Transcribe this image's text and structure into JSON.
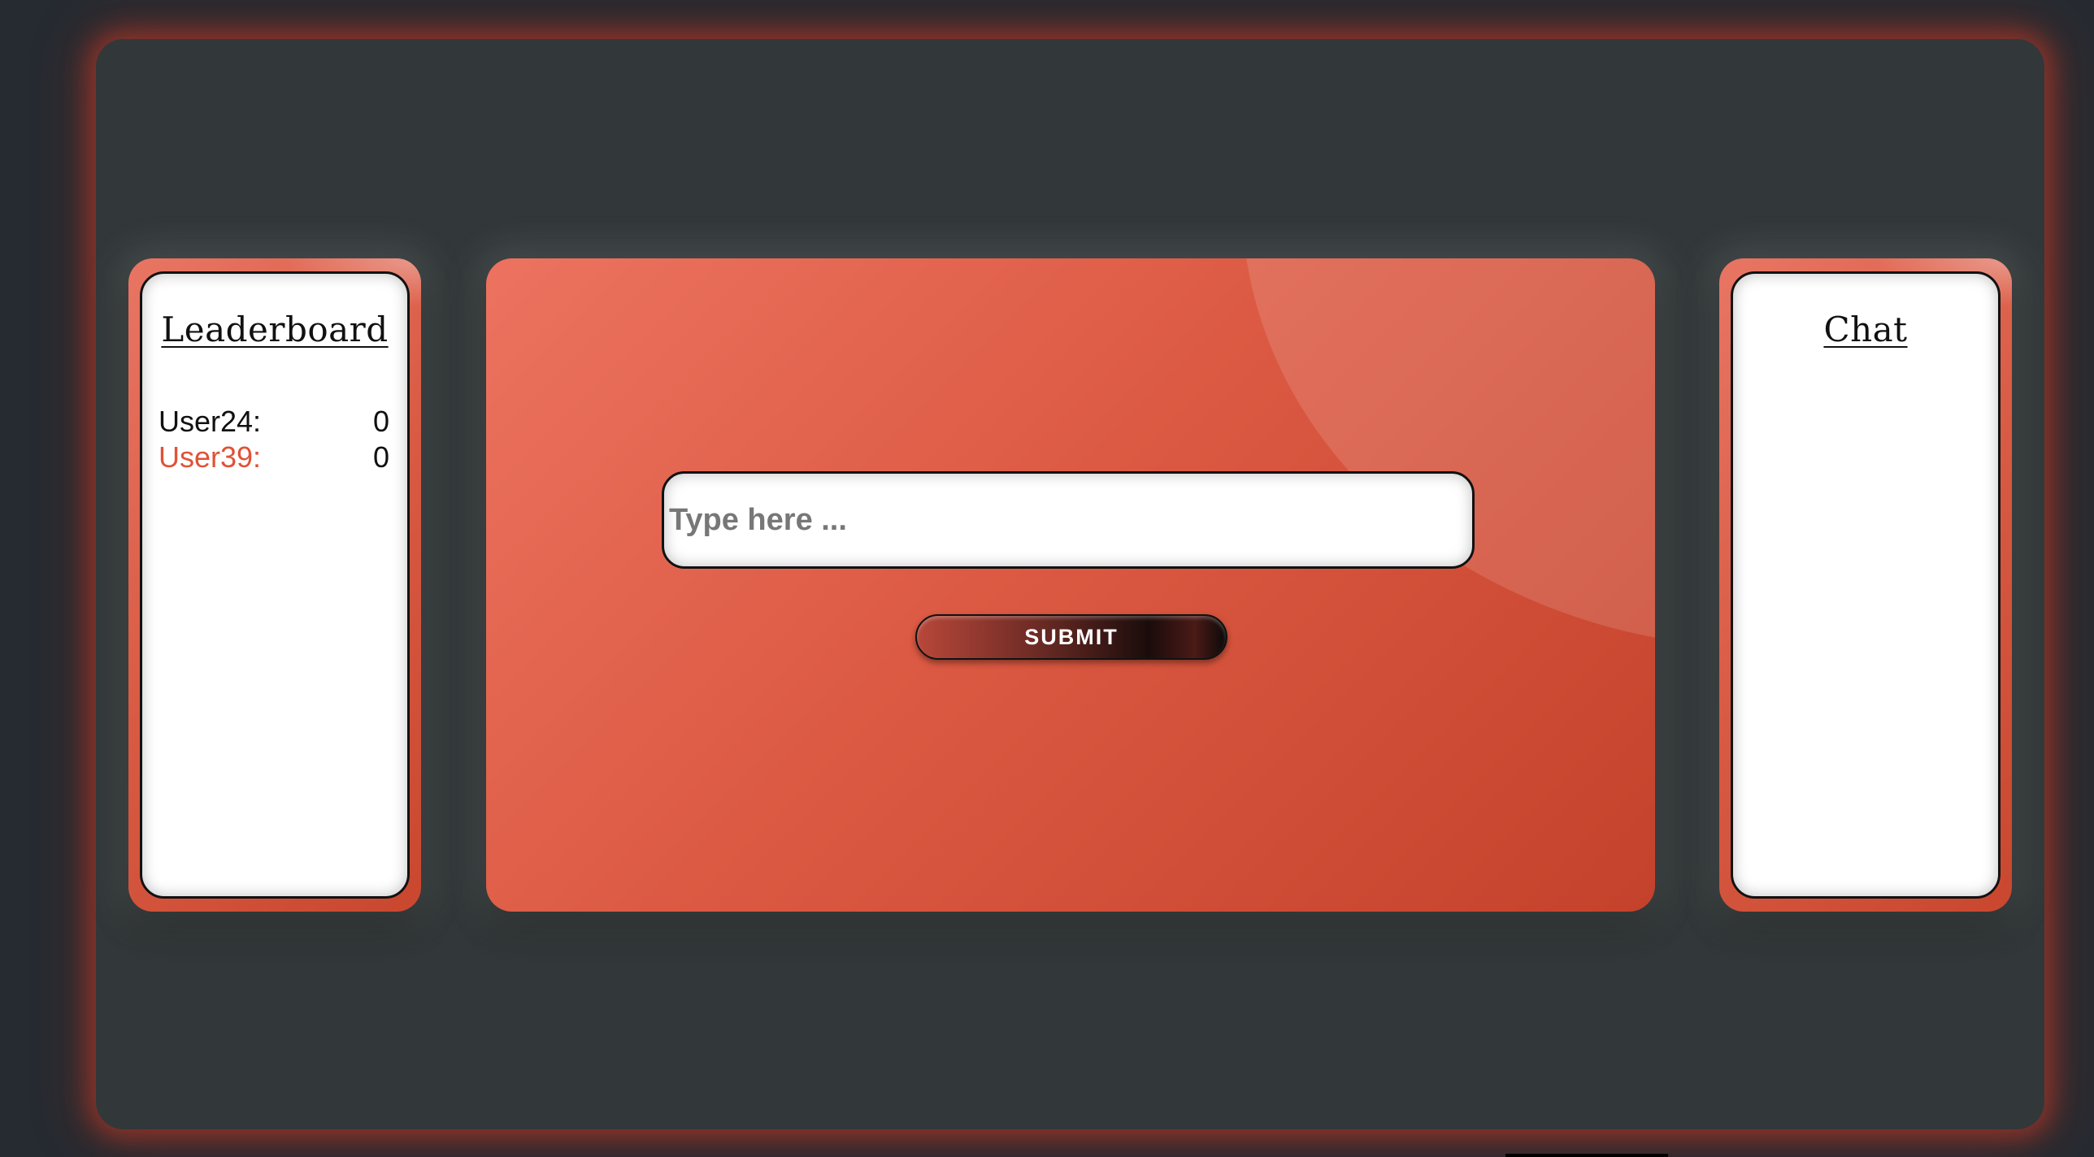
{
  "leaderboard": {
    "title": "Leaderboard",
    "entries": [
      {
        "name": "User24:",
        "score": "0"
      },
      {
        "name": "User39:",
        "score": "0"
      }
    ]
  },
  "main": {
    "input_placeholder": "Type here ...",
    "submit_label": "SUBMIT"
  },
  "chat": {
    "title": "Chat"
  },
  "colors": {
    "accent": "#dc5a43",
    "highlight_user": "#e05236",
    "frame": "#323839",
    "background": "#262b31"
  }
}
